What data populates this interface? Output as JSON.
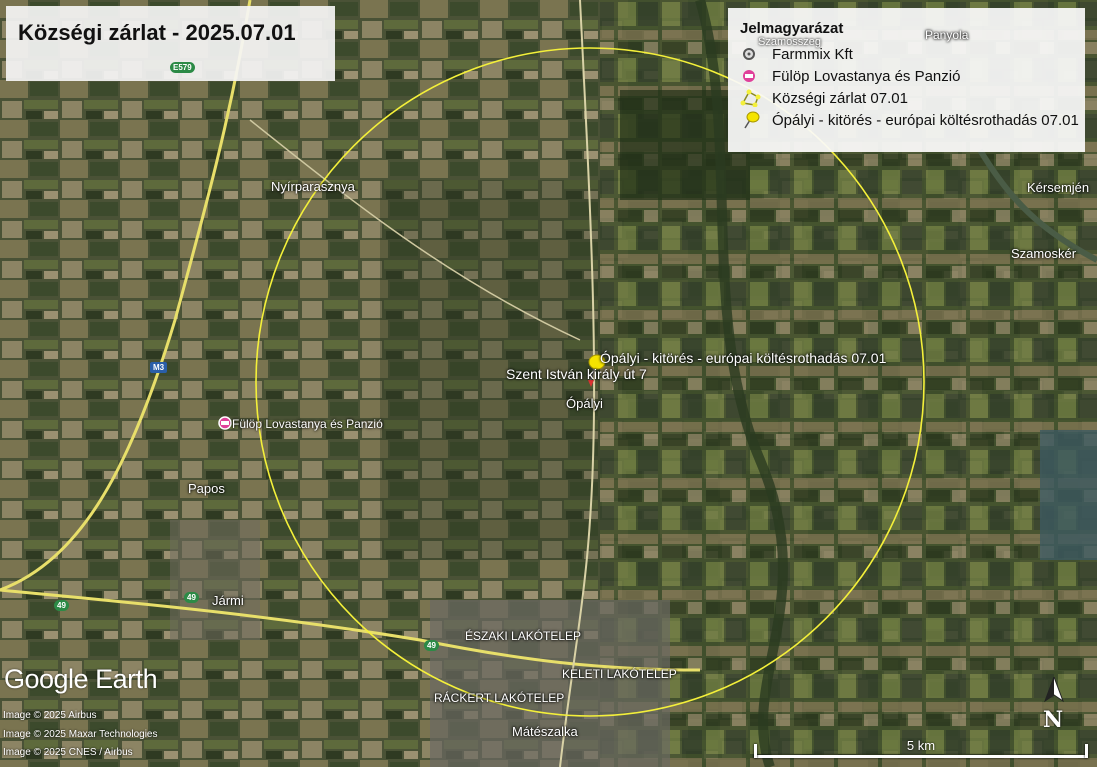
{
  "title": "Községi zárlat - 2025.07.01",
  "legend": {
    "title": "Jelmagyarázat",
    "items": [
      {
        "label": "Farmmix Kft",
        "icon": "grey-circle-icon"
      },
      {
        "label": "Fülöp Lovastanya és Panzió",
        "icon": "pink-place-icon"
      },
      {
        "label": "Községi zárlat 07.01",
        "icon": "yellow-polygon-icon"
      },
      {
        "label": "Ópályi - kitörés - európai költésrothadás 07.01",
        "icon": "yellow-pushpin-icon"
      }
    ]
  },
  "labels": {
    "outbreak": "Ópályi - kitörés - európai költésrothadás 07.01",
    "address": "Szent István király út 7",
    "opalyi": "Ópályi",
    "nyirparasznya": "Nyírparasznya",
    "fulop": "Fülöp Lovastanya és Panzió",
    "papos": "Papos",
    "jarmi": "Jármi",
    "eszaki": "ÉSZAKI LAKÓTELEP",
    "keleti": "KELETI LAKÓTELEP",
    "rackert": "RÁCKERT LAKÓTELEP",
    "mateszalka": "Mátészalka",
    "szamosker": "Szamoskér",
    "kersemjen": "Kérsemjén",
    "panyola": "Panyola",
    "szamosszeg": "Szamosszeg"
  },
  "roads": {
    "m3": "M3",
    "r49a": "49",
    "r49b": "49",
    "r49c": "49",
    "e579": "E579"
  },
  "brand": "Google Earth",
  "credits": [
    "Image © 2025 Airbus",
    "Image © 2025 Maxar Technologies",
    "Image © 2025 CNES / Airbus"
  ],
  "scale": {
    "label": "5 km"
  },
  "north": "N",
  "colors": {
    "zone": "#f4f03a",
    "pin": "#f5e400",
    "place": "#e0409a",
    "road": "#e8df6a"
  }
}
